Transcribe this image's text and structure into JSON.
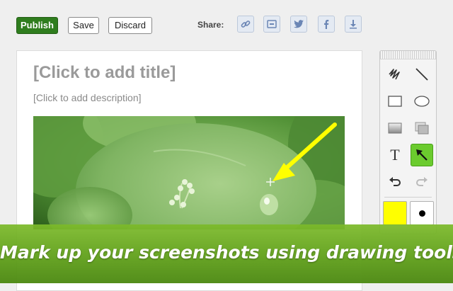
{
  "toolbar": {
    "publish_label": "Publish",
    "save_label": "Save",
    "discard_label": "Discard"
  },
  "share": {
    "label": "Share:",
    "buttons": [
      "link-icon",
      "embed-icon",
      "twitter-icon",
      "facebook-icon",
      "download-icon"
    ]
  },
  "editor": {
    "title_placeholder": "[Click to add title]",
    "description_placeholder": "[Click to add description]"
  },
  "palette": {
    "tools": [
      "freehand-icon",
      "line-icon",
      "rectangle-icon",
      "ellipse-icon",
      "blur-icon",
      "highlight-icon",
      "text-icon",
      "arrow-icon",
      "undo-icon",
      "redo-icon"
    ],
    "active_tool": "arrow-icon",
    "text_tool_label": "T",
    "color": "#ffff00"
  },
  "banner": {
    "text": "Mark up your screenshots using drawing tools"
  },
  "colors": {
    "publish": "#2f7d1e",
    "active_tool": "#6bcb2e",
    "banner": "#6aae22",
    "annotation_arrow": "#ffff00"
  }
}
